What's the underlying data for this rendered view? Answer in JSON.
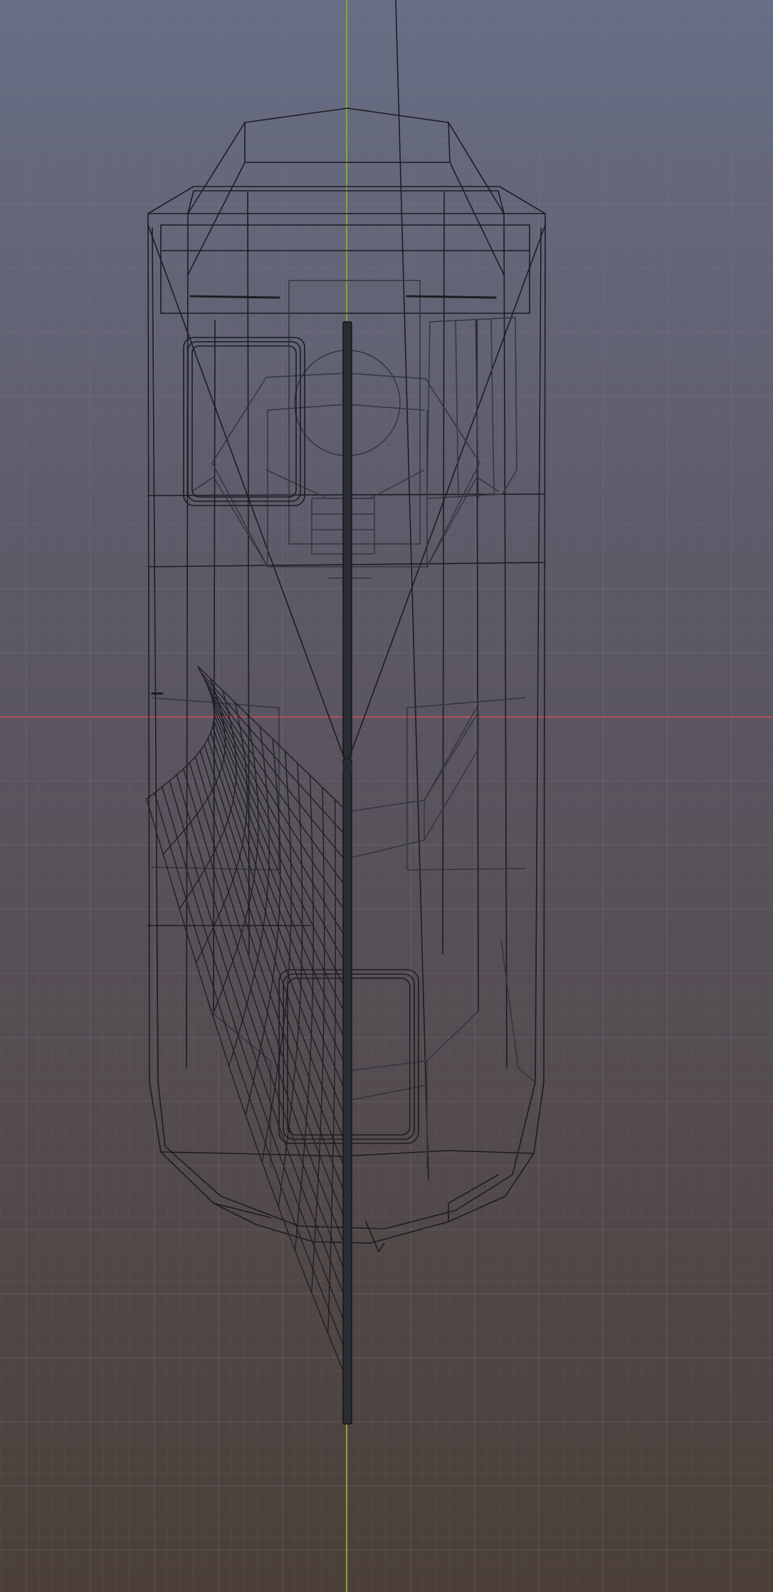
{
  "viewport": {
    "view": "top-orthographic",
    "mode": "wireframe",
    "show_grid": true,
    "show_axes": true,
    "object": "boat-with-sail"
  },
  "colors": {
    "background_top": "#686e85",
    "background_mid": "#5a5560",
    "background_bottom": "#4b3f38",
    "grid_minor": "#7a7682",
    "grid_major": "#8a8592",
    "axis_x": "#b6505c",
    "axis_y": "#82aa2c",
    "wire_dark": "#1c1d22",
    "wire_mid": "#33363e",
    "mast": "#2a2c33"
  },
  "icons": {
    "hull": "boat-hull-wireframe",
    "sail": "sail-mesh-wireframe",
    "mast": "mast-wireframe",
    "cockpit": "cockpit-seat-wireframe"
  }
}
